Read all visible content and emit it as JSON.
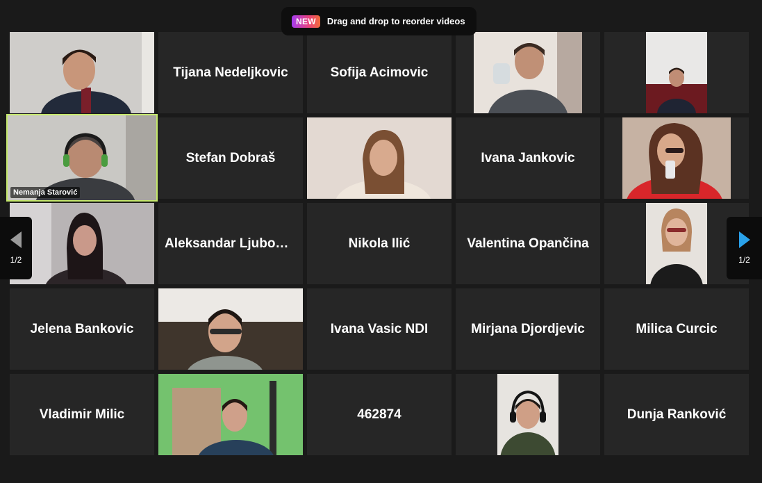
{
  "banner": {
    "badge": "NEW",
    "text": "Drag and drop to reorder videos"
  },
  "pager": {
    "left_count": "1/2",
    "right_count": "1/2"
  },
  "participants": [
    {
      "name": "",
      "video": true
    },
    {
      "name": "Tijana Nedeljkovic",
      "video": false
    },
    {
      "name": "Sofija Acimovic",
      "video": false
    },
    {
      "name": "",
      "video": true
    },
    {
      "name": "",
      "video": true
    },
    {
      "name": "Nemanja Starović",
      "video": true,
      "active": true
    },
    {
      "name": "Stefan Dobraš",
      "video": false
    },
    {
      "name": "",
      "video": true
    },
    {
      "name": "Ivana Jankovic",
      "video": false
    },
    {
      "name": "",
      "video": true
    },
    {
      "name": "",
      "video": true
    },
    {
      "name": "Aleksandar Ljubomi...",
      "video": false
    },
    {
      "name": "Nikola Ilić",
      "video": false
    },
    {
      "name": "Valentina Opančina",
      "video": false
    },
    {
      "name": "",
      "video": true
    },
    {
      "name": "Jelena Bankovic",
      "video": false
    },
    {
      "name": "",
      "video": true
    },
    {
      "name": "Ivana Vasic NDI",
      "video": false
    },
    {
      "name": "Mirjana Djordjevic",
      "video": false
    },
    {
      "name": "Milica Curcic",
      "video": false
    },
    {
      "name": "Vladimir Milic",
      "video": false
    },
    {
      "name": "",
      "video": true
    },
    {
      "name": "462874",
      "video": false
    },
    {
      "name": "",
      "video": true
    },
    {
      "name": "Dunja Ranković",
      "video": false
    }
  ],
  "colors": {
    "active_border": "#c5e86c",
    "tile_bg": "#262626",
    "pager_arrow_active": "#2aa2ea"
  }
}
